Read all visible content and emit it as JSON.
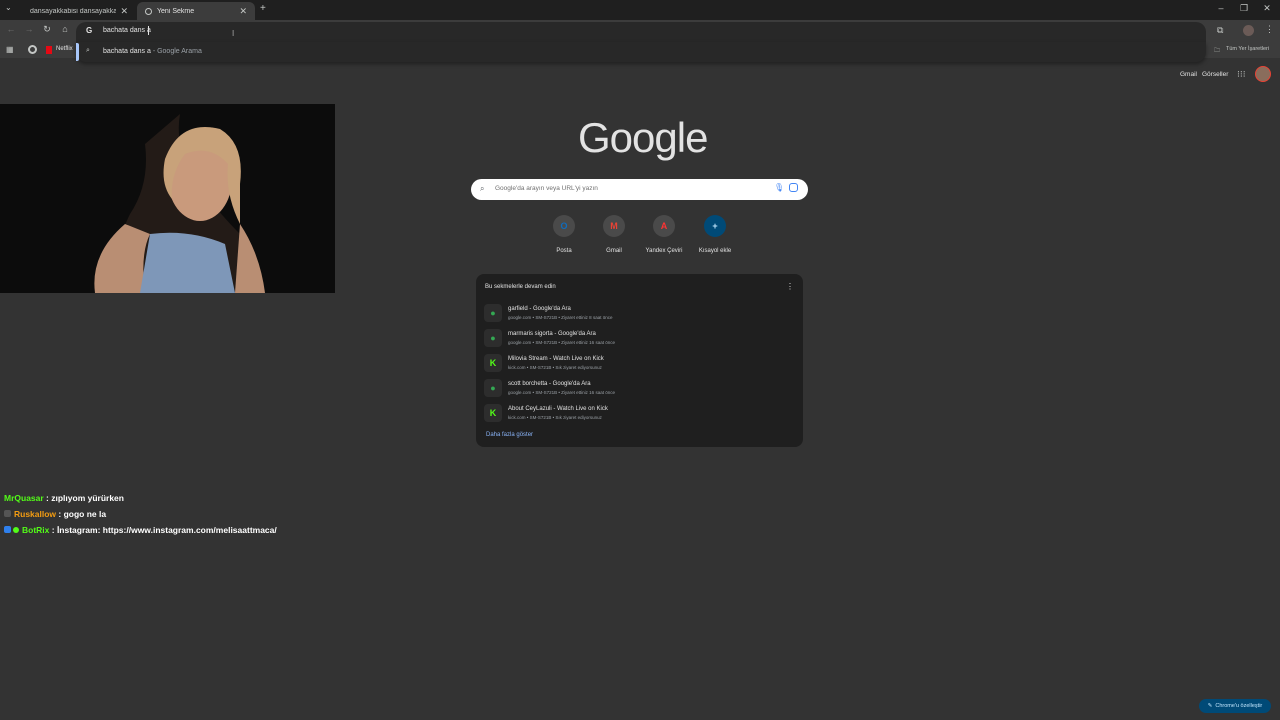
{
  "tabs": [
    {
      "title": "dansayakkabisi dansayakkabısı",
      "close": "✕"
    },
    {
      "title": "Yeni Sekme",
      "close": "✕"
    }
  ],
  "new_tab": "+",
  "omnibox": {
    "value": "bachata dans a"
  },
  "suggestion": {
    "query": "bachata dans a",
    "suffix": " - Google Arama"
  },
  "bookmarks": {
    "netflix": "Netflix",
    "all_bookmarks": "Tüm Yer İşaretleri"
  },
  "top_links": {
    "gmail": "Gmail",
    "images": "Görseller"
  },
  "logo": "Google",
  "search": {
    "placeholder": "Google'da arayın veya URL'yi yazın"
  },
  "shortcuts": [
    {
      "label": "Posta",
      "icon": "outlook-icon",
      "glyph": "O",
      "color": "#0f6cbd"
    },
    {
      "label": "Gmail",
      "icon": "gmail-icon",
      "glyph": "M",
      "color": "#ea4335"
    },
    {
      "label": "Yandex Çeviri",
      "icon": "yandex-translate-icon",
      "glyph": "A",
      "color": "#ff3333"
    },
    {
      "label": "Kısayol ekle",
      "icon": "plus-icon",
      "glyph": "+",
      "color": "#004a77"
    }
  ],
  "resume_card": {
    "title": "Bu sekmelerle devam edin",
    "items": [
      {
        "title": "garfield - Google'da Ara",
        "sub": "google.com • SM-S721B • Ziyaret ettiniz 8 saat önce",
        "icon": "maps-pin-icon",
        "glyph": "●",
        "color": "#34a853"
      },
      {
        "title": "marmaris sigorta - Google'da Ara",
        "sub": "google.com • SM-S721B • Ziyaret ettiniz 16 saat önce",
        "icon": "maps-pin-icon",
        "glyph": "●",
        "color": "#34a853"
      },
      {
        "title": "Milovia Stream - Watch Live on Kick",
        "sub": "kick.com • SM-S721B • Sık ziyaret ediyorsunuz",
        "icon": "kick-icon",
        "glyph": "K",
        "color": "#53fc18"
      },
      {
        "title": "scott borchetta - Google'da Ara",
        "sub": "google.com • SM-S721B • Ziyaret ettiniz 16 saat önce",
        "icon": "maps-pin-icon",
        "glyph": "●",
        "color": "#34a853"
      },
      {
        "title": "About CeyLazuli - Watch Live on Kick",
        "sub": "kick.com • SM-S721B • Sık ziyaret ediyorsunuz",
        "icon": "kick-icon",
        "glyph": "K",
        "color": "#53fc18"
      }
    ],
    "more": "Daha fazla göster"
  },
  "chat": [
    {
      "user": "MrQuasar",
      "color": "#53fc18",
      "message": " : zıplıyom yürürken"
    },
    {
      "user": "Ruskallow",
      "color": "#f39c12",
      "message": " : gogo ne la"
    },
    {
      "user": "BotRix",
      "color": "#53fc18",
      "message": " : İnstagram: https://www.instagram.com/melisaattmaca/"
    }
  ],
  "customize": "Chrome'u özelleştir"
}
